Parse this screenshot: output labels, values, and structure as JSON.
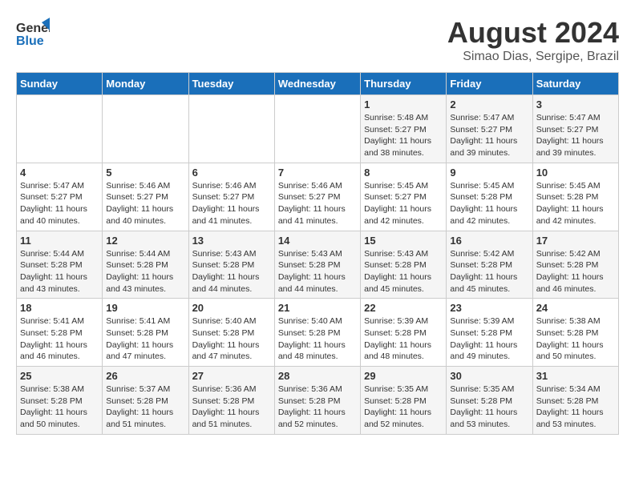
{
  "header": {
    "logo_line1": "General",
    "logo_line2": "Blue",
    "month": "August 2024",
    "location": "Simao Dias, Sergipe, Brazil"
  },
  "weekdays": [
    "Sunday",
    "Monday",
    "Tuesday",
    "Wednesday",
    "Thursday",
    "Friday",
    "Saturday"
  ],
  "weeks": [
    [
      {
        "day": "",
        "info": ""
      },
      {
        "day": "",
        "info": ""
      },
      {
        "day": "",
        "info": ""
      },
      {
        "day": "",
        "info": ""
      },
      {
        "day": "1",
        "info": "Sunrise: 5:48 AM\nSunset: 5:27 PM\nDaylight: 11 hours\nand 38 minutes."
      },
      {
        "day": "2",
        "info": "Sunrise: 5:47 AM\nSunset: 5:27 PM\nDaylight: 11 hours\nand 39 minutes."
      },
      {
        "day": "3",
        "info": "Sunrise: 5:47 AM\nSunset: 5:27 PM\nDaylight: 11 hours\nand 39 minutes."
      }
    ],
    [
      {
        "day": "4",
        "info": "Sunrise: 5:47 AM\nSunset: 5:27 PM\nDaylight: 11 hours\nand 40 minutes."
      },
      {
        "day": "5",
        "info": "Sunrise: 5:46 AM\nSunset: 5:27 PM\nDaylight: 11 hours\nand 40 minutes."
      },
      {
        "day": "6",
        "info": "Sunrise: 5:46 AM\nSunset: 5:27 PM\nDaylight: 11 hours\nand 41 minutes."
      },
      {
        "day": "7",
        "info": "Sunrise: 5:46 AM\nSunset: 5:27 PM\nDaylight: 11 hours\nand 41 minutes."
      },
      {
        "day": "8",
        "info": "Sunrise: 5:45 AM\nSunset: 5:27 PM\nDaylight: 11 hours\nand 42 minutes."
      },
      {
        "day": "9",
        "info": "Sunrise: 5:45 AM\nSunset: 5:28 PM\nDaylight: 11 hours\nand 42 minutes."
      },
      {
        "day": "10",
        "info": "Sunrise: 5:45 AM\nSunset: 5:28 PM\nDaylight: 11 hours\nand 42 minutes."
      }
    ],
    [
      {
        "day": "11",
        "info": "Sunrise: 5:44 AM\nSunset: 5:28 PM\nDaylight: 11 hours\nand 43 minutes."
      },
      {
        "day": "12",
        "info": "Sunrise: 5:44 AM\nSunset: 5:28 PM\nDaylight: 11 hours\nand 43 minutes."
      },
      {
        "day": "13",
        "info": "Sunrise: 5:43 AM\nSunset: 5:28 PM\nDaylight: 11 hours\nand 44 minutes."
      },
      {
        "day": "14",
        "info": "Sunrise: 5:43 AM\nSunset: 5:28 PM\nDaylight: 11 hours\nand 44 minutes."
      },
      {
        "day": "15",
        "info": "Sunrise: 5:43 AM\nSunset: 5:28 PM\nDaylight: 11 hours\nand 45 minutes."
      },
      {
        "day": "16",
        "info": "Sunrise: 5:42 AM\nSunset: 5:28 PM\nDaylight: 11 hours\nand 45 minutes."
      },
      {
        "day": "17",
        "info": "Sunrise: 5:42 AM\nSunset: 5:28 PM\nDaylight: 11 hours\nand 46 minutes."
      }
    ],
    [
      {
        "day": "18",
        "info": "Sunrise: 5:41 AM\nSunset: 5:28 PM\nDaylight: 11 hours\nand 46 minutes."
      },
      {
        "day": "19",
        "info": "Sunrise: 5:41 AM\nSunset: 5:28 PM\nDaylight: 11 hours\nand 47 minutes."
      },
      {
        "day": "20",
        "info": "Sunrise: 5:40 AM\nSunset: 5:28 PM\nDaylight: 11 hours\nand 47 minutes."
      },
      {
        "day": "21",
        "info": "Sunrise: 5:40 AM\nSunset: 5:28 PM\nDaylight: 11 hours\nand 48 minutes."
      },
      {
        "day": "22",
        "info": "Sunrise: 5:39 AM\nSunset: 5:28 PM\nDaylight: 11 hours\nand 48 minutes."
      },
      {
        "day": "23",
        "info": "Sunrise: 5:39 AM\nSunset: 5:28 PM\nDaylight: 11 hours\nand 49 minutes."
      },
      {
        "day": "24",
        "info": "Sunrise: 5:38 AM\nSunset: 5:28 PM\nDaylight: 11 hours\nand 50 minutes."
      }
    ],
    [
      {
        "day": "25",
        "info": "Sunrise: 5:38 AM\nSunset: 5:28 PM\nDaylight: 11 hours\nand 50 minutes."
      },
      {
        "day": "26",
        "info": "Sunrise: 5:37 AM\nSunset: 5:28 PM\nDaylight: 11 hours\nand 51 minutes."
      },
      {
        "day": "27",
        "info": "Sunrise: 5:36 AM\nSunset: 5:28 PM\nDaylight: 11 hours\nand 51 minutes."
      },
      {
        "day": "28",
        "info": "Sunrise: 5:36 AM\nSunset: 5:28 PM\nDaylight: 11 hours\nand 52 minutes."
      },
      {
        "day": "29",
        "info": "Sunrise: 5:35 AM\nSunset: 5:28 PM\nDaylight: 11 hours\nand 52 minutes."
      },
      {
        "day": "30",
        "info": "Sunrise: 5:35 AM\nSunset: 5:28 PM\nDaylight: 11 hours\nand 53 minutes."
      },
      {
        "day": "31",
        "info": "Sunrise: 5:34 AM\nSunset: 5:28 PM\nDaylight: 11 hours\nand 53 minutes."
      }
    ]
  ]
}
